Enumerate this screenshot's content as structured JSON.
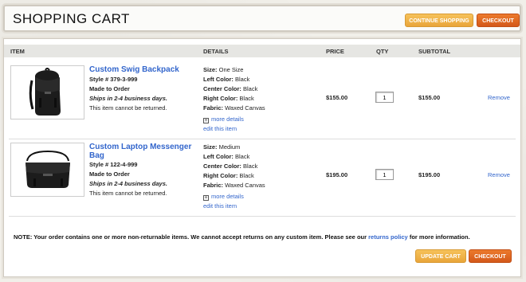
{
  "header": {
    "title": "SHOPPING CART",
    "continue_label": "CONTINUE SHOPPING",
    "checkout_label": "CHECKOUT"
  },
  "table": {
    "columns": [
      "ITEM",
      "DETAILS",
      "PRICE",
      "QTY",
      "SUBTOTAL"
    ]
  },
  "items": [
    {
      "name": "Custom Swig Backpack",
      "style": "Style # 379-3-999",
      "made": "Made to Order",
      "ships": "Ships in 2-4 business days.",
      "returnable": "This item cannot be returned.",
      "details": [
        {
          "label": "Size:",
          "value": "One Size"
        },
        {
          "label": "Left Color:",
          "value": "Black"
        },
        {
          "label": "Center Color:",
          "value": "Black"
        },
        {
          "label": "Right Color:",
          "value": "Black"
        },
        {
          "label": "Fabric:",
          "value": "Waxed Canvas"
        }
      ],
      "more_details": "more details",
      "edit": "edit this item",
      "price": "$155.00",
      "qty": "1",
      "subtotal": "$155.00",
      "remove": "Remove"
    },
    {
      "name": "Custom Laptop Messenger Bag",
      "style": "Style # 122-4-999",
      "made": "Made to Order",
      "ships": "Ships in 2-4 business days.",
      "returnable": "This item cannot be returned.",
      "details": [
        {
          "label": "Size:",
          "value": "Medium"
        },
        {
          "label": "Left Color:",
          "value": "Black"
        },
        {
          "label": "Center Color:",
          "value": "Black"
        },
        {
          "label": "Right Color:",
          "value": "Black"
        },
        {
          "label": "Fabric:",
          "value": "Waxed Canvas"
        }
      ],
      "more_details": "more details",
      "edit": "edit this item",
      "price": "$195.00",
      "qty": "1",
      "subtotal": "$195.00",
      "remove": "Remove"
    }
  ],
  "note": {
    "prefix": "NOTE: Your order contains one or more non-returnable items. We cannot accept returns on any custom item. Please see our",
    "link": "returns policy",
    "suffix": "for more information."
  },
  "footer": {
    "update_label": "UPDATE CART",
    "checkout_label": "CHECKOUT"
  },
  "colors": {
    "link": "#3366cc",
    "button_light": "#f0b44a",
    "button_dark": "#e06a24"
  }
}
